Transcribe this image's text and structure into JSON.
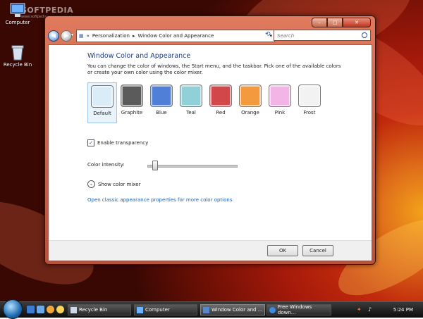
{
  "desktop": {
    "icons": [
      {
        "label": "Computer"
      },
      {
        "label": "Recycle Bin"
      }
    ],
    "watermark": "SOFTPEDIA",
    "watermark_sub": "www.softpedia.com"
  },
  "window": {
    "address": {
      "chevrons": "«",
      "crumb1": "Personalization",
      "sep": "▸",
      "crumb2": "Window Color and Appearance"
    },
    "search_placeholder": "Search",
    "content": {
      "title": "Window Color and Appearance",
      "description": "You can change the color of windows, the Start menu, and the taskbar. Pick one of the available colors or create your own color using the color mixer.",
      "swatches": [
        {
          "label": "Default",
          "color": "#d9ecf7"
        },
        {
          "label": "Graphite",
          "color": "#5b5b5b"
        },
        {
          "label": "Blue",
          "color": "#4f7fd6"
        },
        {
          "label": "Teal",
          "color": "#8fd1d6"
        },
        {
          "label": "Red",
          "color": "#d2474a"
        },
        {
          "label": "Orange",
          "color": "#f39a3e"
        },
        {
          "label": "Pink",
          "color": "#f3b4e6"
        },
        {
          "label": "Frost",
          "color": "#f2f2f2"
        }
      ],
      "selected_swatch": "Default",
      "transparency_label": "Enable transparency",
      "transparency_checked": true,
      "intensity_label": "Color intensity:",
      "intensity_value": 0.06,
      "mixer_label": "Show color mixer",
      "classic_link": "Open classic appearance properties for more color options"
    },
    "buttons": {
      "ok": "OK",
      "cancel": "Cancel"
    }
  },
  "taskbar": {
    "tasks": [
      {
        "label": "Recycle Bin"
      },
      {
        "label": "Computer"
      },
      {
        "label": "Window Color and ..."
      },
      {
        "label": "Free Windows down..."
      }
    ],
    "clock": "5:24 PM"
  },
  "colors": {
    "accent_link": "#1a5fb4",
    "title_blue": "#1c3e8e",
    "window_frame": "#c85d44"
  }
}
